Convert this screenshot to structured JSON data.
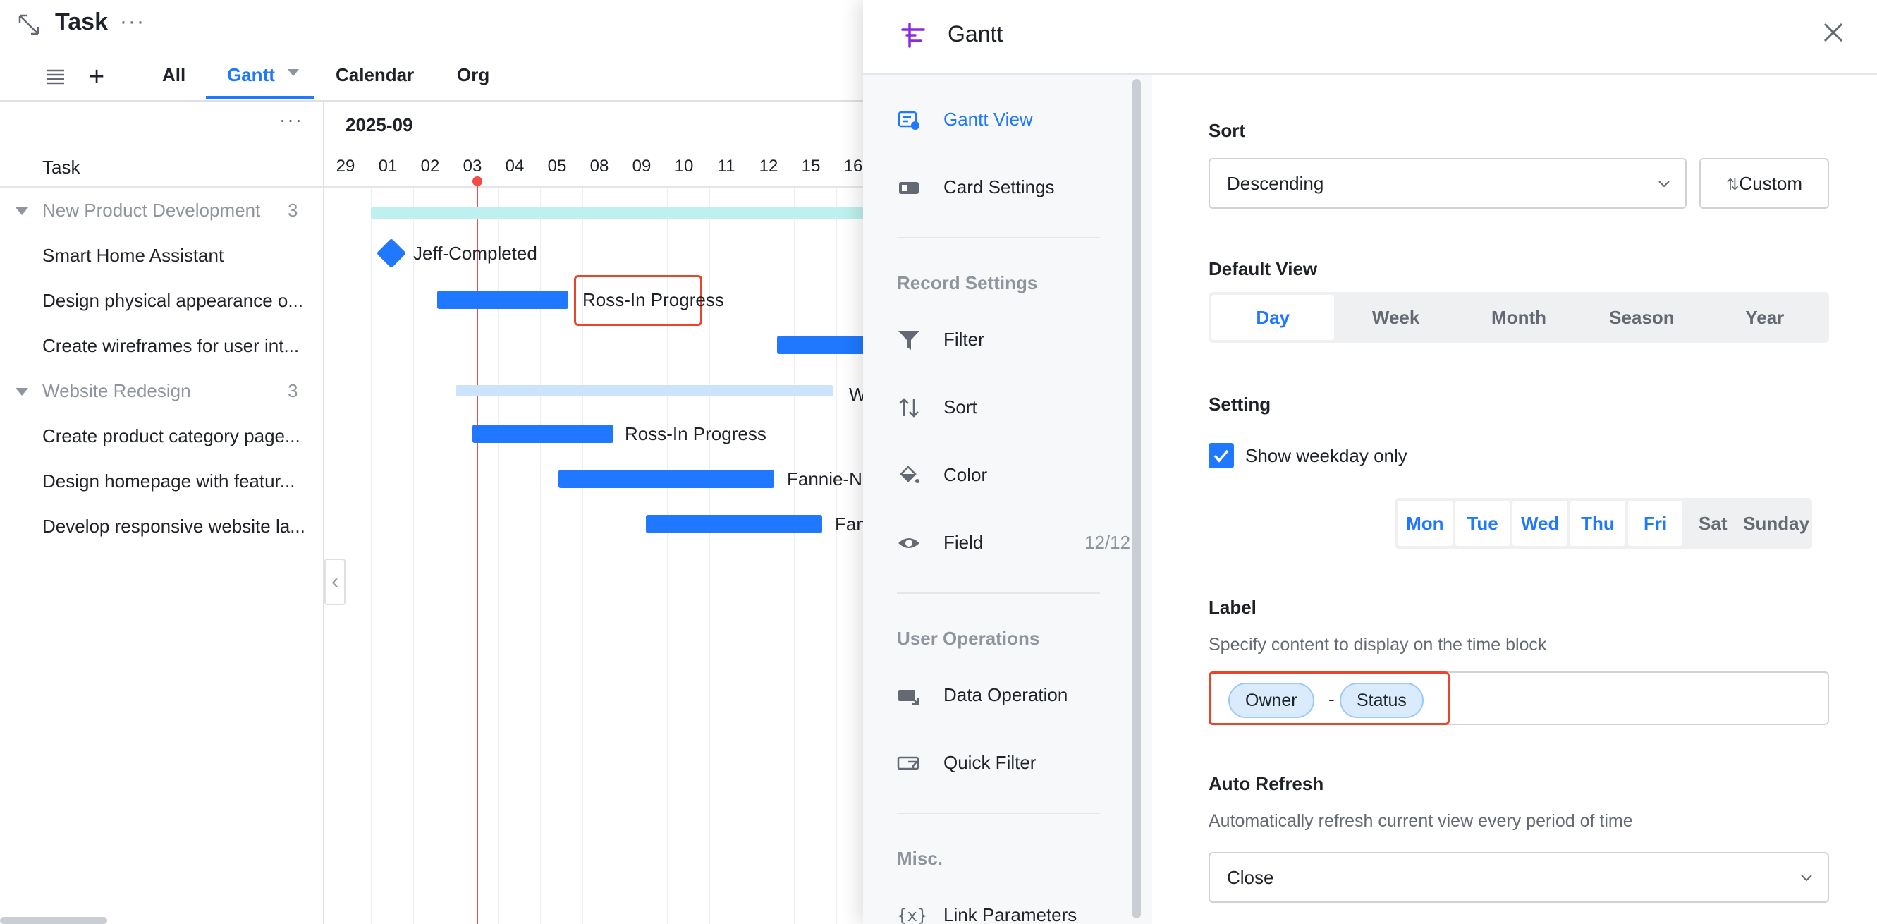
{
  "app": {
    "title": "Task",
    "more": "···",
    "tabs": [
      {
        "label": "All"
      },
      {
        "label": "Gantt"
      },
      {
        "label": "Calendar"
      },
      {
        "label": "Org"
      }
    ],
    "active_tab": "Gantt"
  },
  "task_list": {
    "more": "···",
    "header": "Task",
    "rows": [
      {
        "type": "group",
        "label": "New Product Development",
        "count": "3"
      },
      {
        "type": "task",
        "label": "Smart Home Assistant"
      },
      {
        "type": "task",
        "label": "Design physical appearance o..."
      },
      {
        "type": "task",
        "label": "Create wireframes for user int..."
      },
      {
        "type": "group",
        "label": "Website Redesign",
        "count": "3"
      },
      {
        "type": "task",
        "label": "Create product category page..."
      },
      {
        "type": "task",
        "label": "Design homepage with featur..."
      },
      {
        "type": "task",
        "label": "Develop responsive website la..."
      }
    ]
  },
  "gantt": {
    "month": "2025-09",
    "days": [
      "29",
      "01",
      "02",
      "03",
      "04",
      "05",
      "08",
      "09",
      "10",
      "11",
      "12",
      "15",
      "16"
    ],
    "today": "03",
    "labels": {
      "smart_home": "Jeff-Completed",
      "design_phys": "Ross-In Progress",
      "website_group": "W",
      "category_page": "Ross-In Progress",
      "homepage": "Fannie-N",
      "responsive": "Fan"
    },
    "colors": {
      "bar": "#1f78ff",
      "group1": "#bdf0ee",
      "group2": "#cce4fb",
      "today": "#f54a45"
    }
  },
  "panel": {
    "title": "Gantt",
    "nav": {
      "gantt_view": "Gantt View",
      "card_settings": "Card Settings",
      "record_settings": "Record Settings",
      "filter": "Filter",
      "sort": "Sort",
      "color": "Color",
      "field": "Field",
      "field_count": "12/12",
      "user_operations": "User Operations",
      "data_operation": "Data Operation",
      "quick_filter": "Quick Filter",
      "misc": "Misc.",
      "link_parameters": "Link Parameters"
    },
    "sort": {
      "title": "Sort",
      "value": "Descending",
      "custom": "Custom"
    },
    "default_view": {
      "title": "Default View",
      "options": [
        "Day",
        "Week",
        "Month",
        "Season",
        "Year"
      ],
      "selected": "Day"
    },
    "setting": {
      "title": "Setting",
      "weekday_only": "Show weekday only",
      "days": [
        "Mon",
        "Tue",
        "Wed",
        "Thu",
        "Fri",
        "Sat",
        "Sunday"
      ],
      "selected_days": [
        "Mon",
        "Tue",
        "Wed",
        "Thu",
        "Fri"
      ]
    },
    "label": {
      "title": "Label",
      "desc": "Specify content to display on the time block",
      "chips": [
        "Owner",
        "Status"
      ],
      "separator": "-"
    },
    "auto_refresh": {
      "title": "Auto Refresh",
      "desc": "Automatically refresh current view every period of time",
      "value": "Close"
    }
  }
}
